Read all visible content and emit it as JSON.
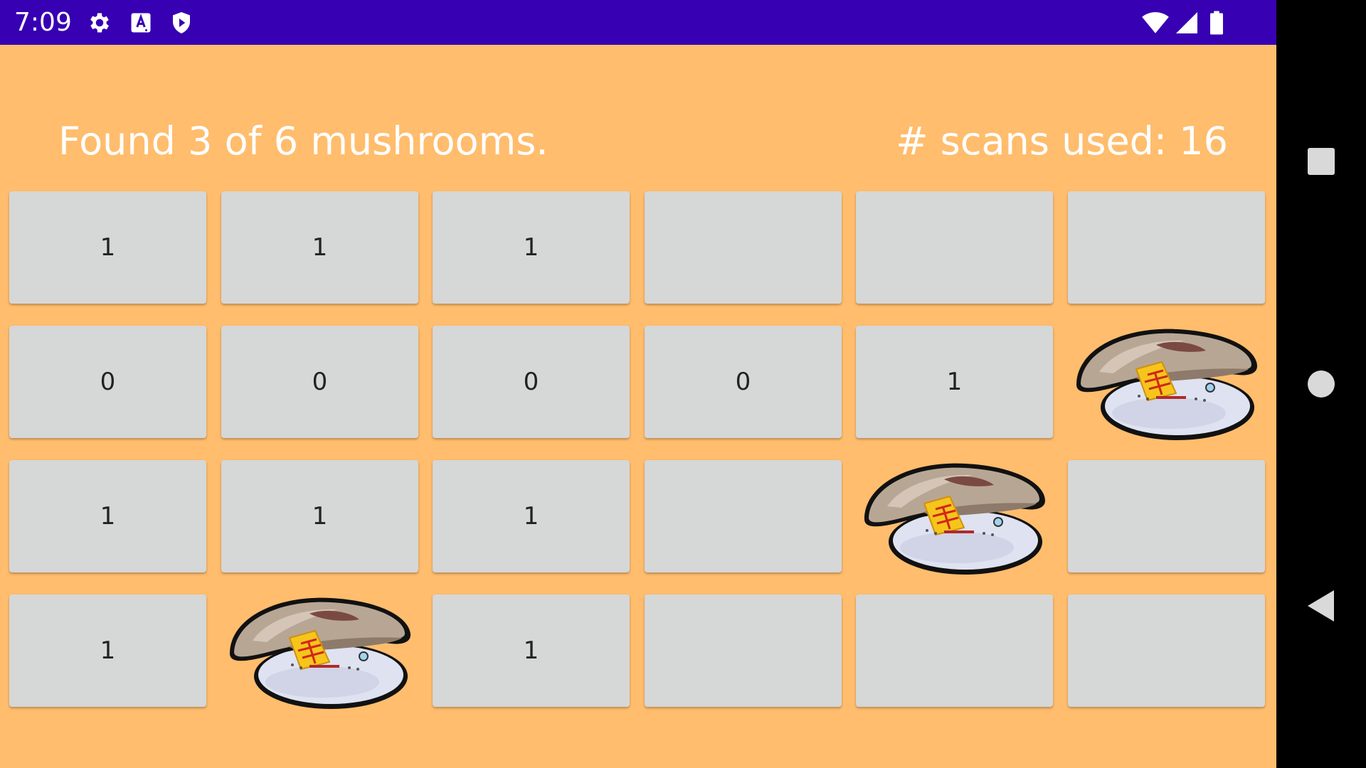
{
  "status_bar": {
    "time": "7:09",
    "left_icons": [
      "settings-icon",
      "font-a-icon",
      "shield-play-icon"
    ],
    "right_icons": [
      "wifi-icon",
      "cell-signal-icon",
      "battery-icon"
    ],
    "background": "#3700b3"
  },
  "game": {
    "found_text": "Found 3 of 6 mushrooms.",
    "scans_text": "# scans used: 16",
    "background": "#ffbd6d",
    "rows": 4,
    "cols": 6,
    "cells": [
      [
        {
          "type": "number",
          "value": "1"
        },
        {
          "type": "number",
          "value": "1"
        },
        {
          "type": "number",
          "value": "1"
        },
        {
          "type": "empty",
          "value": ""
        },
        {
          "type": "empty",
          "value": ""
        },
        {
          "type": "empty",
          "value": ""
        }
      ],
      [
        {
          "type": "number",
          "value": "0"
        },
        {
          "type": "number",
          "value": "0"
        },
        {
          "type": "number",
          "value": "0"
        },
        {
          "type": "number",
          "value": "0"
        },
        {
          "type": "number",
          "value": "1"
        },
        {
          "type": "mushroom",
          "value": ""
        }
      ],
      [
        {
          "type": "number",
          "value": "1"
        },
        {
          "type": "number",
          "value": "1"
        },
        {
          "type": "number",
          "value": "1"
        },
        {
          "type": "empty",
          "value": ""
        },
        {
          "type": "mushroom",
          "value": ""
        },
        {
          "type": "empty",
          "value": ""
        }
      ],
      [
        {
          "type": "number",
          "value": "1"
        },
        {
          "type": "mushroom",
          "value": ""
        },
        {
          "type": "number",
          "value": "1"
        },
        {
          "type": "empty",
          "value": ""
        },
        {
          "type": "empty",
          "value": ""
        },
        {
          "type": "empty",
          "value": ""
        }
      ]
    ]
  },
  "nav_bar": {
    "buttons": [
      "recents-square-icon",
      "home-circle-icon",
      "back-triangle-icon"
    ]
  }
}
